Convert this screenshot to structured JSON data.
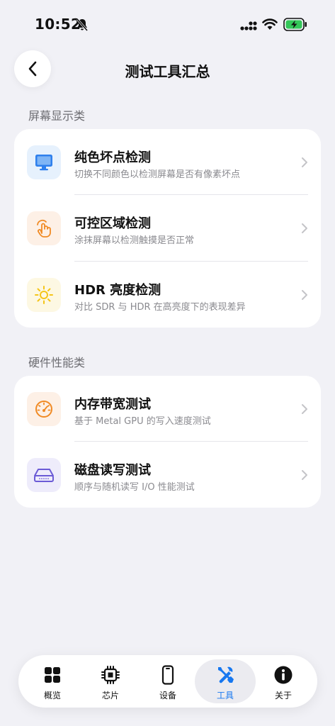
{
  "status_bar": {
    "time": "10:52"
  },
  "nav": {
    "title": "测试工具汇总"
  },
  "sections": [
    {
      "title": "屏幕显示类",
      "items": [
        {
          "title": "纯色坏点检测",
          "subtitle": "切换不同颜色以检测屏幕是否有像素坏点",
          "icon": "display-icon",
          "icon_color": "#2f80ed",
          "icon_bg": "#e6f1fd"
        },
        {
          "title": "可控区域检测",
          "subtitle": "涂抹屏幕以检测触摸是否正常",
          "icon": "hand-tap-icon",
          "icon_color": "#f08a24",
          "icon_bg": "#fdf0e6"
        },
        {
          "title": "HDR 亮度检测",
          "subtitle": "对比 SDR 与 HDR 在高亮度下的表现差异",
          "icon": "sun-icon",
          "icon_color": "#f5c518",
          "icon_bg": "#fdf8e3"
        }
      ]
    },
    {
      "title": "硬件性能类",
      "items": [
        {
          "title": "内存带宽测试",
          "subtitle": "基于 Metal GPU 的写入速度测试",
          "icon": "gauge-icon",
          "icon_color": "#f08a24",
          "icon_bg": "#fdf0e6"
        },
        {
          "title": "磁盘读写测试",
          "subtitle": "顺序与随机读写 I/O 性能测试",
          "icon": "drive-icon",
          "icon_color": "#6b5bd6",
          "icon_bg": "#eeecfb"
        }
      ]
    }
  ],
  "tab_bar": {
    "active_color": "#1677f0",
    "tabs": [
      {
        "label": "概览",
        "icon": "grid-icon"
      },
      {
        "label": "芯片",
        "icon": "chip-icon"
      },
      {
        "label": "设备",
        "icon": "phone-icon"
      },
      {
        "label": "工具",
        "icon": "tools-icon",
        "active": true
      },
      {
        "label": "关于",
        "icon": "info-icon"
      }
    ]
  }
}
